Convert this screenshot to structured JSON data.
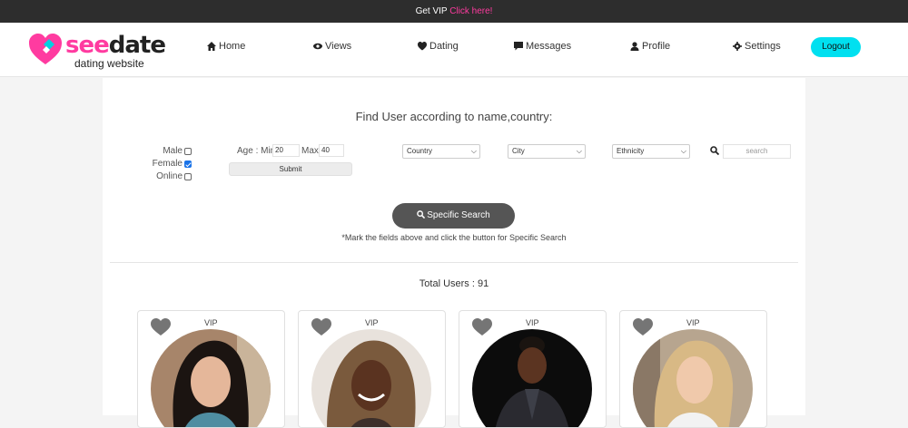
{
  "topbar": {
    "text": "Get VIP",
    "link": "Click here!"
  },
  "logo": {
    "see": "see",
    "date": "date",
    "tagline": "dating website"
  },
  "nav": {
    "home": "Home",
    "views": "Views",
    "dating": "Dating",
    "messages": "Messages",
    "profile": "Profile",
    "settings": "Settings",
    "logout": "Logout"
  },
  "search": {
    "title": "Find User according to name,country:",
    "male": "Male",
    "female": "Female",
    "online": "Online",
    "age_min_label": "Age : Min",
    "age_min_value": "20",
    "age_max_label": "Max",
    "age_max_value": "40",
    "submit": "Submit",
    "country": "Country",
    "city": "City",
    "ethnicity": "Ethnicity",
    "search_placeholder": "search",
    "specific_button": "Specific Search",
    "note": "*Mark the fields above and click the button for Specific Search"
  },
  "results": {
    "total": "Total Users : 91",
    "cards": [
      {
        "badge": "VIP"
      },
      {
        "badge": "VIP"
      },
      {
        "badge": "VIP"
      },
      {
        "badge": "VIP"
      }
    ]
  },
  "colors": {
    "accent": "#ff3ba0",
    "logout": "#00e0f0",
    "button": "#555555"
  }
}
